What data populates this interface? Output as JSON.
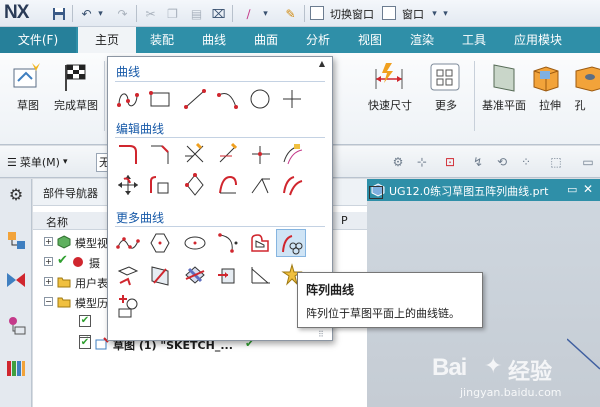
{
  "app": {
    "logo": "NX"
  },
  "quick_access": {
    "switch_window": "切换窗口",
    "window": "窗口"
  },
  "tabs": [
    {
      "label": "文件(F)"
    },
    {
      "label": "主页"
    },
    {
      "label": "装配"
    },
    {
      "label": "曲线"
    },
    {
      "label": "曲面"
    },
    {
      "label": "分析"
    },
    {
      "label": "视图"
    },
    {
      "label": "渲染"
    },
    {
      "label": "工具"
    },
    {
      "label": "应用模块"
    }
  ],
  "ribbon": {
    "sketch": "草图",
    "finish_sketch": "完成草图",
    "quick_dim": "快速尺寸",
    "more": "更多",
    "datum_plane": "基准平面",
    "extrude": "拉伸",
    "hole": "孔"
  },
  "toolbar2": {
    "menu": "菜单(M)",
    "filter_value": "无"
  },
  "navigator": {
    "title": "部件导航器",
    "col_name": "名称",
    "col_p": "P",
    "rows": [
      {
        "label": "模型视"
      },
      {
        "label": "摄"
      },
      {
        "label": "用户表"
      },
      {
        "label": "模型历"
      },
      {
        "label": ""
      },
      {
        "label": ""
      },
      {
        "label": "草图 (1)  \"SKETCH_..."
      }
    ]
  },
  "graphics": {
    "tab_title": "UG12.0练习草图五阵列曲线.prt"
  },
  "gallery": {
    "sections": [
      {
        "title": "曲线",
        "icons": [
          "arc-curve-icon",
          "rectangle-icon",
          "line-icon",
          "arc-3pt-icon",
          "circle-icon",
          "point-icon"
        ]
      },
      {
        "title": "编辑曲线",
        "icons": [
          "fillet-icon",
          "chamfer-icon",
          "quick-trim-icon",
          "quick-extend-icon",
          "make-corner-icon",
          "offset-move-icon",
          "move-curve-icon",
          "offset-curve-icon",
          "resize-icon",
          "delete-curve-icon",
          "corner-icon",
          "mirror-curve-icon"
        ]
      },
      {
        "title": "更多曲线",
        "icons": [
          "studio-spline-icon",
          "polygon-icon",
          "ellipse-icon",
          "conic-icon",
          "offset-shape-icon",
          "pattern-curve-icon",
          "project-curve-icon",
          "derived-line-icon",
          "intersect-curve-icon",
          "add-existing-icon",
          "intersection-point-icon",
          "mirror-icon",
          "rect-circle-icon"
        ]
      }
    ]
  },
  "tooltip": {
    "title": "阵列曲线",
    "description": "阵列位于草图平面上的曲线链。"
  },
  "watermark": {
    "brand": "Bai",
    "brand2": "经验",
    "url": "jingyan.baidu.com"
  },
  "colors": {
    "accent": "#2f8fa8",
    "gallery_head": "#1659a8",
    "curve_red": "#d0262e"
  }
}
